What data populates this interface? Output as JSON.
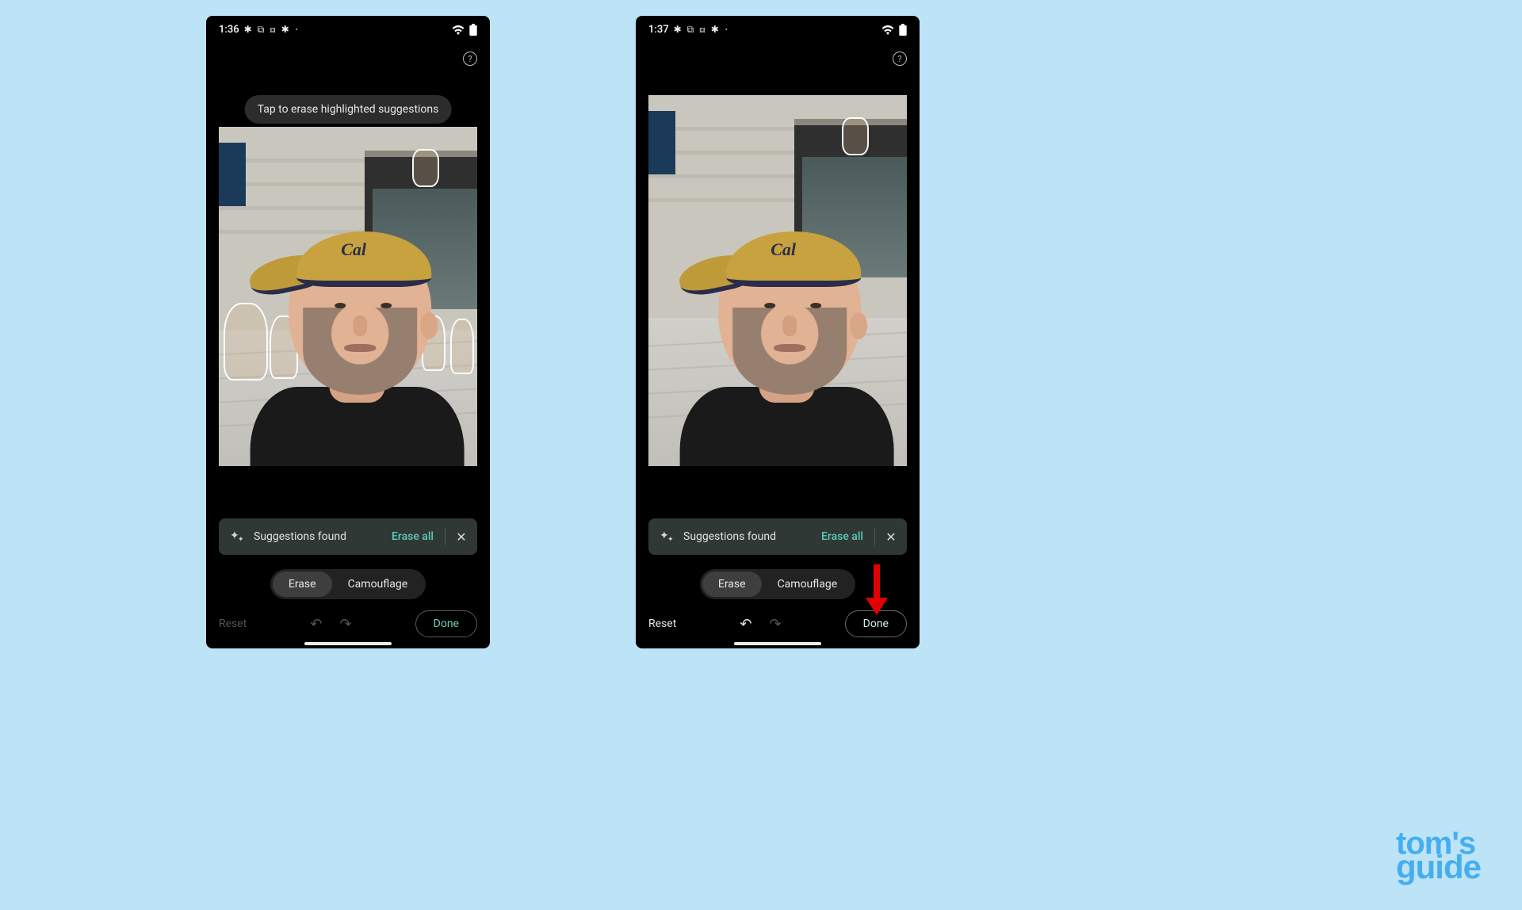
{
  "watermark": {
    "line1": "tom's",
    "line2": "guide"
  },
  "screens": [
    {
      "statusbar": {
        "time": "1:36",
        "notification_glyphs": "✱ ⧉ ⧈ ✱",
        "dot": "•",
        "wifi": "wifi-icon",
        "battery": "battery-icon"
      },
      "tooltip": "Tap to erase highlighted suggestions",
      "show_tooltip": true,
      "show_highlights": true,
      "help": "?",
      "suggestions": {
        "label": "Suggestions found",
        "erase_all": "Erase all",
        "close": "✕"
      },
      "modes": {
        "erase": "Erase",
        "camouflage": "Camouflage",
        "active": "erase"
      },
      "bottom": {
        "reset": "Reset",
        "reset_enabled": false,
        "undo_enabled": false,
        "redo_enabled": false,
        "done": "Done",
        "done_accent": true
      },
      "arrow": false
    },
    {
      "statusbar": {
        "time": "1:37",
        "notification_glyphs": "✱ ⧉ ⧈ ✱",
        "dot": "•",
        "wifi": "wifi-icon",
        "battery": "battery-icon"
      },
      "tooltip": "",
      "show_tooltip": false,
      "show_highlights": false,
      "help": "?",
      "suggestions": {
        "label": "Suggestions found",
        "erase_all": "Erase all",
        "close": "✕"
      },
      "modes": {
        "erase": "Erase",
        "camouflage": "Camouflage",
        "active": "erase"
      },
      "bottom": {
        "reset": "Reset",
        "reset_enabled": true,
        "undo_enabled": true,
        "redo_enabled": false,
        "done": "Done",
        "done_accent": false
      },
      "arrow": true
    }
  ]
}
